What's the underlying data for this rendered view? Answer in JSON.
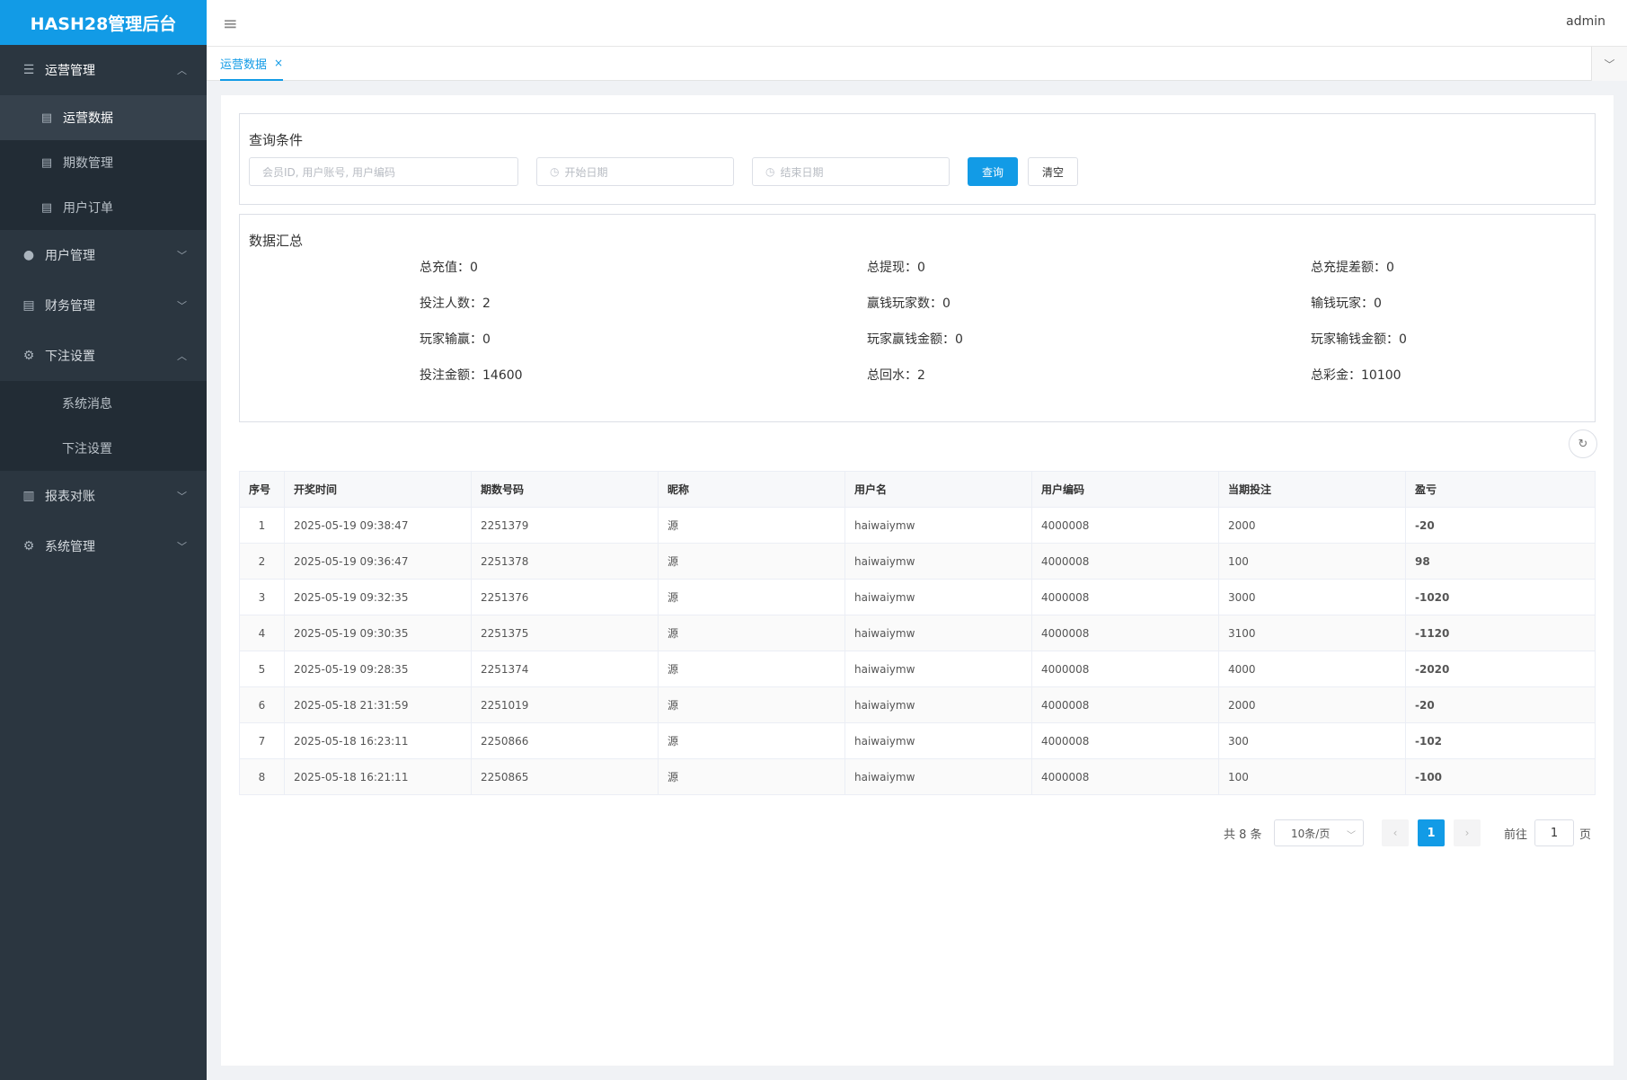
{
  "app": {
    "brand": "HASH28管理后台",
    "user": "admin"
  },
  "sidebar": {
    "groups": [
      {
        "label": "运营管理",
        "icon": "list-icon",
        "expanded": true,
        "items": [
          {
            "label": "运营数据",
            "icon": "doc-icon",
            "active": true
          },
          {
            "label": "期数管理",
            "icon": "doc-icon"
          },
          {
            "label": "用户订单",
            "icon": "doc-icon"
          }
        ]
      },
      {
        "label": "用户管理",
        "icon": "user-icon",
        "expanded": false
      },
      {
        "label": "财务管理",
        "icon": "doc-icon",
        "expanded": false
      },
      {
        "label": "下注设置",
        "icon": "gear-icon",
        "expanded": true,
        "items": [
          {
            "label": "系统消息"
          },
          {
            "label": "下注设置"
          }
        ]
      },
      {
        "label": "报表对账",
        "icon": "report-icon",
        "expanded": false
      },
      {
        "label": "系统管理",
        "icon": "gear-icon",
        "expanded": false
      }
    ]
  },
  "tabs": {
    "active": "运营数据",
    "close": "×"
  },
  "query": {
    "title": "查询条件",
    "member_placeholder": "会员ID, 用户账号, 用户编码",
    "start_placeholder": "开始日期",
    "end_placeholder": "结束日期",
    "search_label": "查询",
    "clear_label": "清空"
  },
  "summary": {
    "title": "数据汇总",
    "rows": [
      [
        "总充值：0",
        "总提现：0",
        "总充提差额：0"
      ],
      [
        "投注人数：2",
        "赢钱玩家数：0",
        "输钱玩家：0"
      ],
      [
        "玩家输赢：0",
        "玩家赢钱金额：0",
        "玩家输钱金额：0"
      ],
      [
        "投注金额：14600",
        "总回水：2",
        "总彩金：10100"
      ]
    ]
  },
  "table": {
    "headers": [
      "序号",
      "开奖时间",
      "期数号码",
      "昵称",
      "用户名",
      "用户编码",
      "当期投注",
      "盈亏"
    ],
    "rows": [
      [
        "1",
        "2025-05-19 09:38:47",
        "2251379",
        "源",
        "haiwaiymw",
        "4000008",
        "2000",
        "-20"
      ],
      [
        "2",
        "2025-05-19 09:36:47",
        "2251378",
        "源",
        "haiwaiymw",
        "4000008",
        "100",
        "98"
      ],
      [
        "3",
        "2025-05-19 09:32:35",
        "2251376",
        "源",
        "haiwaiymw",
        "4000008",
        "3000",
        "-1020"
      ],
      [
        "4",
        "2025-05-19 09:30:35",
        "2251375",
        "源",
        "haiwaiymw",
        "4000008",
        "3100",
        "-1120"
      ],
      [
        "5",
        "2025-05-19 09:28:35",
        "2251374",
        "源",
        "haiwaiymw",
        "4000008",
        "4000",
        "-2020"
      ],
      [
        "6",
        "2025-05-18 21:31:59",
        "2251019",
        "源",
        "haiwaiymw",
        "4000008",
        "2000",
        "-20"
      ],
      [
        "7",
        "2025-05-18 16:23:11",
        "2250866",
        "源",
        "haiwaiymw",
        "4000008",
        "300",
        "-102"
      ],
      [
        "8",
        "2025-05-18 16:21:11",
        "2250865",
        "源",
        "haiwaiymw",
        "4000008",
        "100",
        "-100"
      ]
    ]
  },
  "pagination": {
    "total": "共 8 条",
    "page_size": "10条/页",
    "current": "1",
    "goto_label": "前往",
    "goto_value": "1",
    "page_suffix": "页"
  },
  "colors": {
    "accent": "#129be6",
    "sidebar": "#2b3640",
    "loss": "#11a05a",
    "gain": "#d11d1d"
  }
}
